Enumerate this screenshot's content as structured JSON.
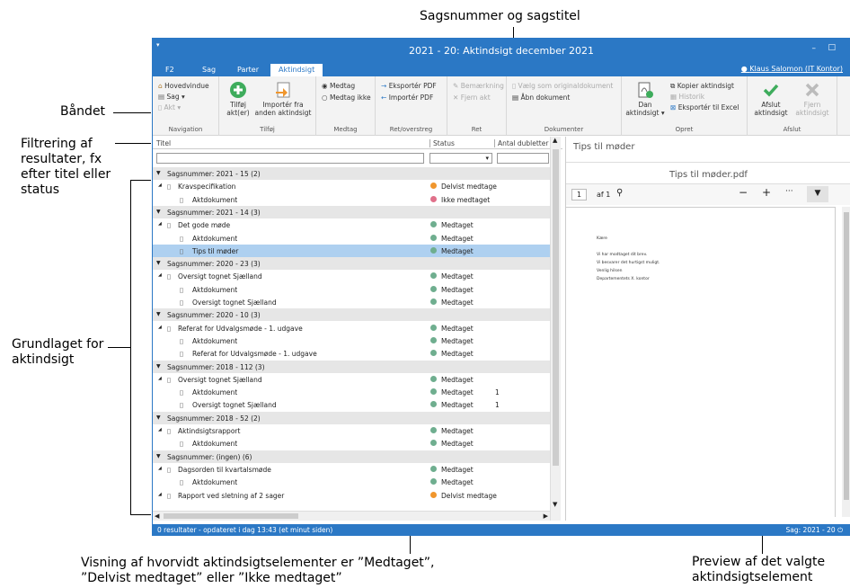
{
  "callouts": {
    "top": "Sagsnummer og sagstitel",
    "ribbon": "Båndet",
    "filter": "Filtrering af resultater, fx efter titel eller status",
    "basis": "Grundlaget for aktindsigt",
    "status_line1": "Visning af hvorvidt aktindsigtselementer er ”Medtaget”,",
    "status_line2": "”Delvist medtaget” eller ”Ikke medtaget”",
    "preview": "Preview af det valgte aktindsigtselement"
  },
  "app": {
    "title": "2021 - 20: Aktindsigt december 2021",
    "user": "Klaus Salomon (IT Kontor)",
    "tabs": [
      "F2",
      "Sag",
      "Parter",
      "Aktindsigt"
    ],
    "ribbon": {
      "nav": {
        "items": [
          "Hovedvindue",
          "Sag ▾",
          "Akt ▾"
        ],
        "label": "Navigation"
      },
      "tilfoj": {
        "btn1": "Tilføj akt(er)",
        "btn2": "Importér fra anden aktindsigt",
        "label": "Tilføj"
      },
      "medtag": {
        "opt1": "Medtag",
        "opt2": "Medtag ikke",
        "label": "Medtag"
      },
      "ret": {
        "items": [
          "Eksportér PDF",
          "Importér PDF"
        ],
        "label": "Ret/overstreg"
      },
      "ret2": {
        "items": [
          "Bemærkning",
          "Fjern akt"
        ],
        "label": "Ret"
      },
      "dok": {
        "items": [
          "Vælg som originaldokument",
          "Åbn dokument"
        ],
        "label": "Dokumenter"
      },
      "opret": {
        "big": "Dan aktindsigt ▾",
        "items": [
          "Kopier aktindsigt",
          "Historik",
          "Eksportér til Excel"
        ],
        "label": "Opret"
      },
      "afslut": {
        "btn1": "Afslut aktindsigt",
        "btn2": "Fjern aktindsigt",
        "label": "Afslut"
      }
    },
    "columns": {
      "title": "Titel",
      "status": "Status",
      "dupes": "Antal dubletter"
    },
    "rows": [
      {
        "kind": "group",
        "text": "Sagsnummer: 2021 - 15 (2)"
      },
      {
        "kind": "parent",
        "text": "Kravspecifikation",
        "status": "Delvist medtage",
        "color": "#f0962d"
      },
      {
        "kind": "child",
        "text": "Aktdokument",
        "status": "Ikke medtaget",
        "color": "#e0708a"
      },
      {
        "kind": "group",
        "text": "Sagsnummer: 2021 - 14 (3)"
      },
      {
        "kind": "parent",
        "text": "Det gode møde",
        "status": "Medtaget",
        "color": "#6fae8f"
      },
      {
        "kind": "child",
        "text": "Aktdokument",
        "status": "Medtaget",
        "color": "#6fae8f"
      },
      {
        "kind": "child",
        "text": "Tips til møder",
        "status": "Medtaget",
        "color": "#6fae8f",
        "sel": true
      },
      {
        "kind": "group",
        "text": "Sagsnummer: 2020 - 23 (3)"
      },
      {
        "kind": "parent",
        "text": "Oversigt tognet Sjælland",
        "status": "Medtaget",
        "color": "#6fae8f"
      },
      {
        "kind": "child",
        "text": "Aktdokument",
        "status": "Medtaget",
        "color": "#6fae8f"
      },
      {
        "kind": "child",
        "text": "Oversigt tognet Sjælland",
        "status": "Medtaget",
        "color": "#6fae8f"
      },
      {
        "kind": "group",
        "text": "Sagsnummer: 2020 - 10 (3)"
      },
      {
        "kind": "parent",
        "text": "Referat for Udvalgsmøde - 1. udgave",
        "status": "Medtaget",
        "color": "#6fae8f"
      },
      {
        "kind": "child",
        "text": "Aktdokument",
        "status": "Medtaget",
        "color": "#6fae8f"
      },
      {
        "kind": "child",
        "text": "Referat for Udvalgsmøde - 1. udgave",
        "status": "Medtaget",
        "color": "#6fae8f"
      },
      {
        "kind": "group",
        "text": "Sagsnummer: 2018 - 112 (3)"
      },
      {
        "kind": "parent",
        "text": "Oversigt tognet Sjælland",
        "status": "Medtaget",
        "color": "#6fae8f"
      },
      {
        "kind": "child",
        "text": "Aktdokument",
        "status": "Medtaget",
        "color": "#6fae8f",
        "dup": "1"
      },
      {
        "kind": "child",
        "text": "Oversigt tognet Sjælland",
        "status": "Medtaget",
        "color": "#6fae8f",
        "dup": "1"
      },
      {
        "kind": "group",
        "text": "Sagsnummer: 2018 - 52 (2)"
      },
      {
        "kind": "parent",
        "text": "Aktindsigtsrapport",
        "status": "Medtaget",
        "color": "#6fae8f"
      },
      {
        "kind": "child",
        "text": "Aktdokument",
        "status": "Medtaget",
        "color": "#6fae8f"
      },
      {
        "kind": "group",
        "text": "Sagsnummer: (ingen) (6)"
      },
      {
        "kind": "parent",
        "text": "Dagsorden til kvartalsmøde",
        "status": "Medtaget",
        "color": "#6fae8f"
      },
      {
        "kind": "child",
        "text": "Aktdokument",
        "status": "Medtaget",
        "color": "#6fae8f"
      },
      {
        "kind": "parent",
        "text": "Rapport ved sletning af 2 sager",
        "status": "Delvist medtage",
        "color": "#f0962d"
      }
    ],
    "preview": {
      "heading": "Tips til møder",
      "file": "Tips til møder.pdf",
      "page": "1",
      "of": "af 1",
      "doc_lines": [
        "Kære",
        "Vi har modtaget dit brev.",
        "Vi besvarer det hurtigst muligt.",
        "Venlig hilsen",
        "Departementets X. kontor"
      ]
    },
    "status_left": "0 resultater - opdateret i dag 13:43 (et minut siden)",
    "status_right": "Sag: 2021 - 20"
  }
}
